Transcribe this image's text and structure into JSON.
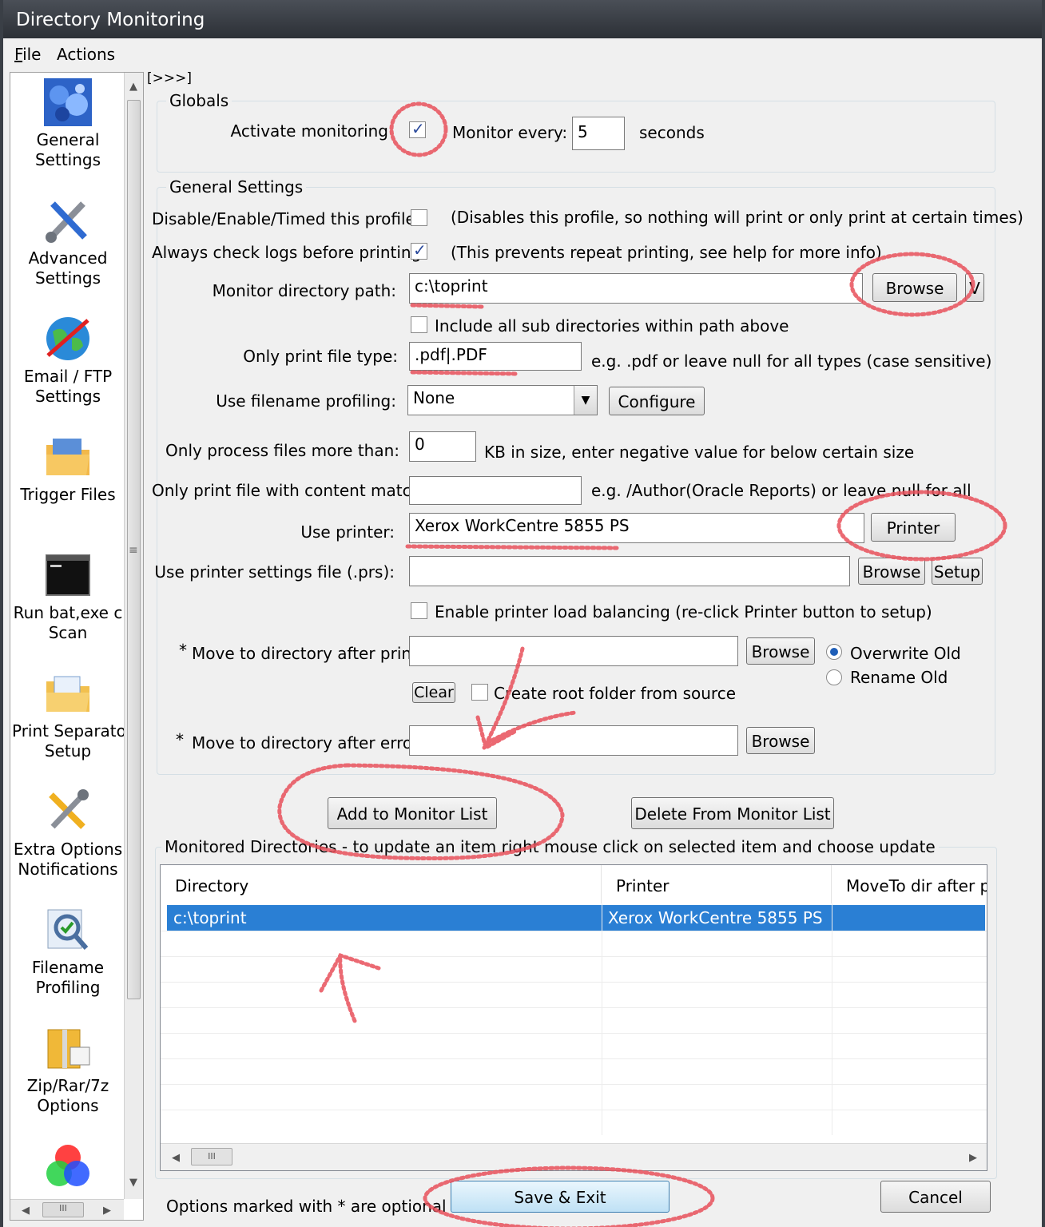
{
  "window": {
    "title": "Directory Monitoring"
  },
  "menu": {
    "file_underline": "F",
    "file_rest": "ile",
    "actions": "Actions"
  },
  "sidebar": {
    "items": [
      {
        "line1": "General",
        "line2": "Settings",
        "icon": "general-settings-icon"
      },
      {
        "line1": "Advanced",
        "line2": "Settings",
        "icon": "tools-icon"
      },
      {
        "line1": "Email / FTP",
        "line2": "Settings",
        "icon": "globe-icon"
      },
      {
        "line1": "Trigger Files",
        "line2": "",
        "icon": "folder-icon"
      },
      {
        "line1": "Run bat,exe c",
        "line2": "Scan",
        "icon": "console-icon"
      },
      {
        "line1": "Print Separato",
        "line2": "Setup",
        "icon": "folder-document-icon"
      },
      {
        "line1": "Extra Options",
        "line2": "Notifications",
        "icon": "wrench-screwdriver-icon"
      },
      {
        "line1": "Filename",
        "line2": "Profiling",
        "icon": "magnifier-check-icon"
      },
      {
        "line1": "Zip/Rar/7z",
        "line2": "Options",
        "icon": "archive-icon"
      }
    ],
    "scroll_grip": "≡",
    "hscroll_grip": "III"
  },
  "expander": "[>>>]",
  "globals": {
    "title": "Globals",
    "activate_label": "Activate monitoring",
    "activate_checked": true,
    "monitor_every_label": "Monitor every:",
    "interval_value": "5",
    "seconds_label": "seconds"
  },
  "general": {
    "title": "General Settings",
    "disable_label": "Disable/Enable/Timed this profile",
    "disable_hint": "(Disables this profile, so nothing will print or only print at certain times)",
    "logs_label": "Always check logs before printing",
    "logs_hint": "(This prevents repeat printing, see help for more info)",
    "dir_label": "Monitor directory path:",
    "dir_value": "c:\\toprint",
    "browse_label": "Browse",
    "v_label": "V",
    "subdirs_label": "Include all sub directories within path above",
    "filetype_label": "Only print file type:",
    "filetype_value": ".pdf|.PDF",
    "filetype_hint": "e.g. .pdf or leave null for all types (case sensitive)",
    "profiling_label": "Use filename profiling:",
    "profiling_value": "None",
    "configure_label": "Configure",
    "size_label": "Only process files more than:",
    "size_value": "0",
    "size_hint": "KB in size, enter negative value for below certain size",
    "content_label": "Only print file with content match:",
    "content_value": "",
    "content_hint": "e.g. /Author(Oracle Reports) or leave null for all",
    "printer_label": "Use printer:",
    "printer_value": "Xerox WorkCentre 5855 PS",
    "printer_button": "Printer",
    "prs_label": "Use printer settings file (.prs):",
    "prs_value": "",
    "prs_browse": "Browse",
    "prs_setup": "Setup",
    "balance_label": "Enable printer load balancing (re-click Printer button to setup)",
    "move_label": "Move to directory after print:",
    "move_value": "",
    "move_browse": "Browse",
    "overwrite_label": "Overwrite Old",
    "rename_label": "Rename Old",
    "clear_label": "Clear",
    "root_label": "Create root folder from source",
    "error_label": "Move to directory after error:",
    "error_value": "",
    "error_browse": "Browse",
    "asterisk": "*"
  },
  "actions": {
    "add": "Add to Monitor List",
    "delete": "Delete From Monitor List"
  },
  "monitored": {
    "title": "Monitored Directories  -  to update an item right mouse click on selected item and choose update",
    "columns": [
      "Directory",
      "Printer",
      "MoveTo dir after pri"
    ],
    "rows": [
      {
        "directory": "c:\\toprint",
        "printer": "Xerox WorkCentre 5855 PS",
        "moveto": ""
      }
    ]
  },
  "footer": {
    "note": "Options marked with * are optional",
    "save": "Save & Exit",
    "cancel": "Cancel"
  },
  "colors": {
    "selection": "#2a7fd4",
    "annotation": "#e8505a"
  }
}
